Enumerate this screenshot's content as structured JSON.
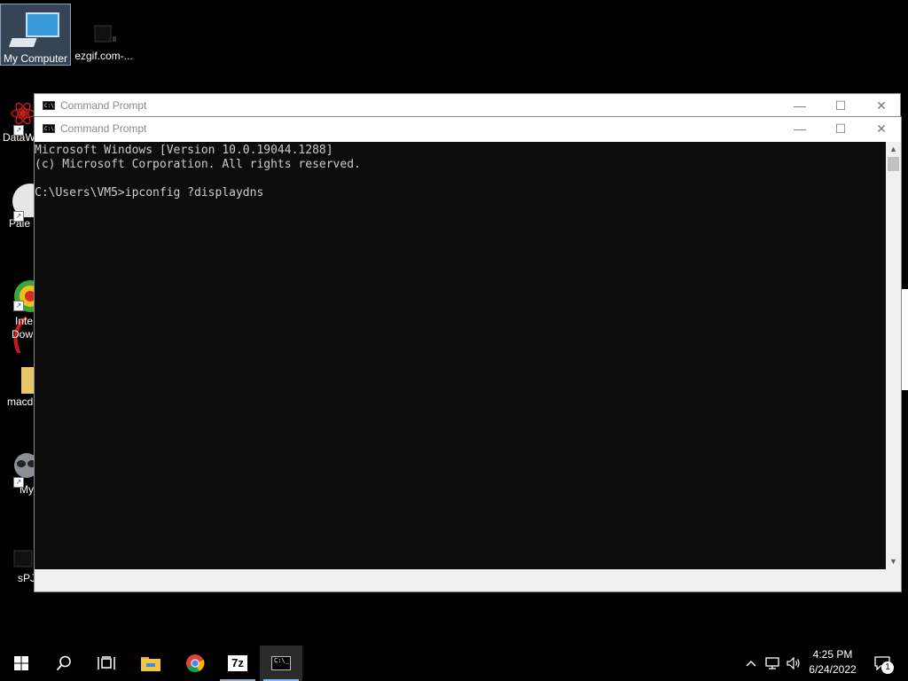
{
  "desktop": {
    "icons": [
      {
        "label": "My Computer"
      },
      {
        "label": "ezgif.com-..."
      },
      {
        "label": "DataW"
      },
      {
        "label": "Pale M"
      },
      {
        "label": "Inte"
      },
      {
        "label": "Dow"
      },
      {
        "label": "macd"
      },
      {
        "label": "My"
      },
      {
        "label": "sPJ"
      }
    ]
  },
  "back_window": {
    "title": "Command Prompt",
    "minimize": "—",
    "maximize": "☐",
    "close": "✕"
  },
  "front_window": {
    "title": "Command Prompt",
    "minimize": "—",
    "maximize": "☐",
    "close": "✕",
    "console_lines": [
      "Microsoft Windows [Version 10.0.19044.1288]",
      "(c) Microsoft Corporation. All rights reserved.",
      "",
      "C:\\Users\\VM5>ipconfig ?displaydns"
    ]
  },
  "taskbar": {
    "items": [
      {
        "icon": "windows-start-icon"
      },
      {
        "icon": "search-icon"
      },
      {
        "icon": "task-view-icon"
      },
      {
        "icon": "file-explorer-icon"
      },
      {
        "icon": "chrome-icon"
      },
      {
        "icon": "7zip-icon",
        "text": "7z"
      },
      {
        "icon": "command-prompt-icon",
        "active": true
      }
    ],
    "clock": {
      "time": "4:25 PM",
      "date": "6/24/2022"
    },
    "notification_count": "1"
  },
  "colors": {
    "console_bg": "#0c0c0c",
    "console_fg": "#cccccc",
    "taskbar_bg": "#000000",
    "accent": "#8ab4ff"
  }
}
